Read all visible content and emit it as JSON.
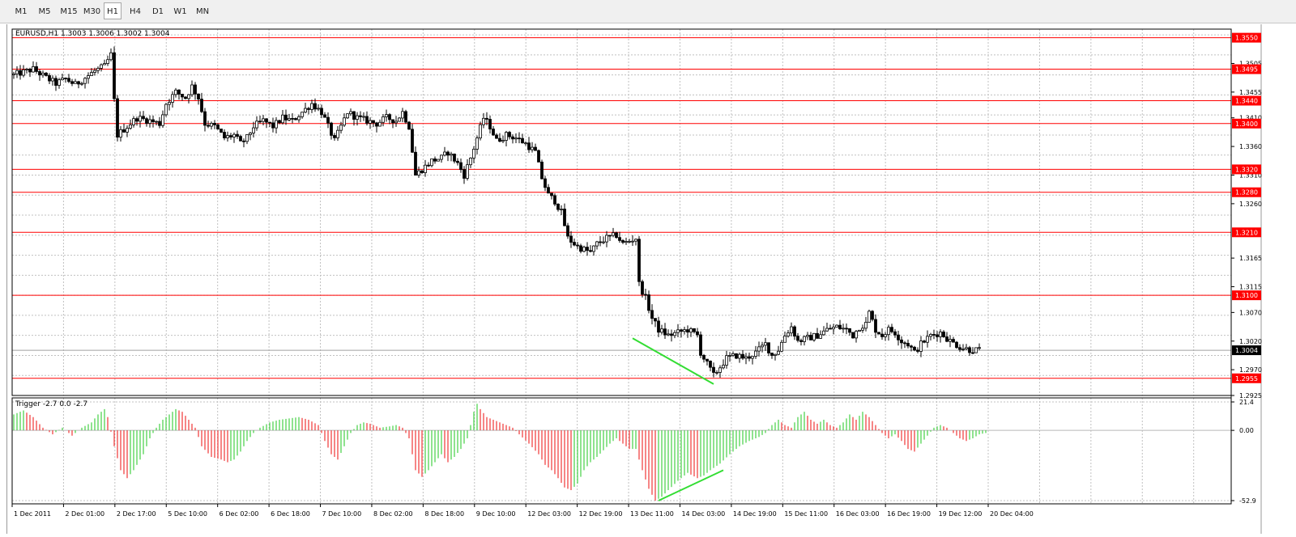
{
  "toolbar": {
    "timeframes": [
      "M1",
      "M5",
      "M15",
      "M30",
      "H1",
      "H4",
      "D1",
      "W1",
      "MN"
    ],
    "active": "H1"
  },
  "chart": {
    "header": "EURUSD,H1  1.3003 1.3006 1.3002 1.3004",
    "symbol": "EURUSD",
    "timeframe": "H1",
    "ohlc": [
      1.3003,
      1.3006,
      1.3002,
      1.3004
    ],
    "current_price": "1.3004",
    "colors": {
      "level_line": "#ff0000",
      "candle": "#000000",
      "trendline": "#33dd33",
      "bar_up": "#33cc33",
      "bar_down": "#ee2222"
    }
  },
  "indicator": {
    "header": "Trigger -2.7 0.0 -2.7",
    "name": "Trigger",
    "values": [
      -2.7,
      0.0,
      -2.7
    ]
  },
  "chart_data": [
    {
      "type": "candlestick",
      "series_name": "EURUSD,H1",
      "ylim": [
        1.2925,
        1.3565
      ],
      "y_ticks": [
        "1.3550",
        "1.3505",
        "1.3495",
        "1.3455",
        "1.3440",
        "1.3410",
        "1.3400",
        "1.3360",
        "1.3320",
        "1.3310",
        "1.3280",
        "1.3260",
        "1.3210",
        "1.3165",
        "1.3115",
        "1.3100",
        "1.3070",
        "1.3020",
        "1.3004",
        "1.2970",
        "1.2955",
        "1.2925"
      ],
      "x_ticks": [
        "1 Dec 2011",
        "2 Dec 01:00",
        "2 Dec 17:00",
        "5 Dec 10:00",
        "6 Dec 02:00",
        "6 Dec 18:00",
        "7 Dec 10:00",
        "8 Dec 02:00",
        "8 Dec 18:00",
        "9 Dec 10:00",
        "12 Dec 03:00",
        "12 Dec 19:00",
        "13 Dec 11:00",
        "14 Dec 03:00",
        "14 Dec 19:00",
        "15 Dec 11:00",
        "16 Dec 03:00",
        "16 Dec 19:00",
        "19 Dec 12:00",
        "20 Dec 04:00"
      ],
      "horizontal_levels": [
        "1.3550",
        "1.3495",
        "1.3440",
        "1.3400",
        "1.3320",
        "1.3280",
        "1.3210",
        "1.3100",
        "1.2955"
      ],
      "close_path": [
        [
          0,
          1.3485
        ],
        [
          3,
          1.349
        ],
        [
          6,
          1.3495
        ],
        [
          10,
          1.348
        ],
        [
          13,
          1.347
        ],
        [
          16,
          1.3478
        ],
        [
          19,
          1.3468
        ],
        [
          22,
          1.348
        ],
        [
          25,
          1.3492
        ],
        [
          28,
          1.35
        ],
        [
          30,
          1.352
        ],
        [
          31,
          1.344
        ],
        [
          32,
          1.338
        ],
        [
          35,
          1.3395
        ],
        [
          38,
          1.341
        ],
        [
          42,
          1.3405
        ],
        [
          45,
          1.34
        ],
        [
          47,
          1.3435
        ],
        [
          50,
          1.3455
        ],
        [
          53,
          1.3445
        ],
        [
          55,
          1.3465
        ],
        [
          57,
          1.3445
        ],
        [
          59,
          1.34
        ],
        [
          62,
          1.3395
        ],
        [
          65,
          1.3375
        ],
        [
          68,
          1.338
        ],
        [
          70,
          1.3365
        ],
        [
          72,
          1.3375
        ],
        [
          74,
          1.3395
        ],
        [
          77,
          1.3405
        ],
        [
          80,
          1.3395
        ],
        [
          83,
          1.341
        ],
        [
          86,
          1.3405
        ],
        [
          89,
          1.342
        ],
        [
          92,
          1.3435
        ],
        [
          95,
          1.342
        ],
        [
          97,
          1.3395
        ],
        [
          99,
          1.337
        ],
        [
          101,
          1.3395
        ],
        [
          103,
          1.342
        ],
        [
          106,
          1.341
        ],
        [
          109,
          1.3405
        ],
        [
          112,
          1.34
        ],
        [
          115,
          1.341
        ],
        [
          118,
          1.3405
        ],
        [
          120,
          1.342
        ],
        [
          122,
          1.3395
        ],
        [
          124,
          1.331
        ],
        [
          126,
          1.332
        ],
        [
          129,
          1.3335
        ],
        [
          132,
          1.334
        ],
        [
          134,
          1.335
        ],
        [
          137,
          1.333
        ],
        [
          139,
          1.331
        ],
        [
          141,
          1.334
        ],
        [
          143,
          1.3375
        ],
        [
          145,
          1.341
        ],
        [
          147,
          1.3395
        ],
        [
          149,
          1.337
        ],
        [
          152,
          1.338
        ],
        [
          155,
          1.3375
        ],
        [
          158,
          1.3365
        ],
        [
          161,
          1.335
        ],
        [
          163,
          1.3305
        ],
        [
          165,
          1.3275
        ],
        [
          167,
          1.3265
        ],
        [
          169,
          1.3245
        ],
        [
          171,
          1.32
        ],
        [
          174,
          1.3185
        ],
        [
          176,
          1.318
        ],
        [
          178,
          1.3175
        ],
        [
          180,
          1.319
        ],
        [
          183,
          1.32
        ],
        [
          186,
          1.3205
        ],
        [
          188,
          1.319
        ],
        [
          190,
          1.3195
        ],
        [
          192,
          1.32
        ],
        [
          193,
          1.312
        ],
        [
          195,
          1.3095
        ],
        [
          197,
          1.306
        ],
        [
          199,
          1.304
        ],
        [
          202,
          1.303
        ],
        [
          205,
          1.3035
        ],
        [
          208,
          1.304
        ],
        [
          211,
          1.303
        ],
        [
          212,
          1.3
        ],
        [
          214,
          1.298
        ],
        [
          216,
          1.296
        ],
        [
          218,
          1.2975
        ],
        [
          220,
          1.299
        ],
        [
          223,
          1.2995
        ],
        [
          226,
          1.299
        ],
        [
          229,
          1.3
        ],
        [
          232,
          1.3015
        ],
        [
          234,
          1.2995
        ],
        [
          236,
          1.3005
        ],
        [
          238,
          1.303
        ],
        [
          240,
          1.3045
        ],
        [
          242,
          1.302
        ],
        [
          245,
          1.3025
        ],
        [
          248,
          1.303
        ],
        [
          251,
          1.304
        ],
        [
          254,
          1.3045
        ],
        [
          257,
          1.304
        ],
        [
          259,
          1.303
        ],
        [
          261,
          1.3045
        ],
        [
          263,
          1.305
        ],
        [
          264,
          1.307
        ],
        [
          266,
          1.304
        ],
        [
          268,
          1.303
        ],
        [
          270,
          1.304
        ],
        [
          272,
          1.3035
        ],
        [
          274,
          1.302
        ],
        [
          276,
          1.3015
        ],
        [
          278,
          1.3
        ],
        [
          280,
          1.3015
        ],
        [
          283,
          1.303
        ],
        [
          286,
          1.3035
        ],
        [
          289,
          1.302
        ],
        [
          292,
          1.301
        ],
        [
          295,
          1.3005
        ],
        [
          298,
          1.3004
        ]
      ]
    },
    {
      "type": "histogram",
      "series_name": "Trigger",
      "ylim": [
        -52.9,
        21.4
      ],
      "y_ticks": [
        "21.4",
        "0.00",
        "-52.9"
      ],
      "current_values": [
        -2.7,
        0.0,
        -2.7
      ],
      "path": [
        [
          0,
          12
        ],
        [
          3,
          15
        ],
        [
          6,
          10
        ],
        [
          9,
          2
        ],
        [
          12,
          -3
        ],
        [
          15,
          2
        ],
        [
          18,
          -4
        ],
        [
          21,
          2
        ],
        [
          24,
          6
        ],
        [
          26,
          12
        ],
        [
          28,
          16
        ],
        [
          29,
          10
        ],
        [
          31,
          -12
        ],
        [
          33,
          -30
        ],
        [
          35,
          -36
        ],
        [
          37,
          -30
        ],
        [
          40,
          -18
        ],
        [
          42,
          -6
        ],
        [
          44,
          2
        ],
        [
          46,
          8
        ],
        [
          48,
          12
        ],
        [
          50,
          16
        ],
        [
          52,
          14
        ],
        [
          54,
          8
        ],
        [
          56,
          2
        ],
        [
          58,
          -12
        ],
        [
          61,
          -20
        ],
        [
          64,
          -22
        ],
        [
          66,
          -24
        ],
        [
          68,
          -22
        ],
        [
          70,
          -16
        ],
        [
          72,
          -8
        ],
        [
          74,
          -2
        ],
        [
          76,
          2
        ],
        [
          79,
          6
        ],
        [
          82,
          8
        ],
        [
          85,
          9
        ],
        [
          88,
          10
        ],
        [
          91,
          8
        ],
        [
          94,
          4
        ],
        [
          96,
          -8
        ],
        [
          98,
          -18
        ],
        [
          100,
          -22
        ],
        [
          102,
          -12
        ],
        [
          104,
          -2
        ],
        [
          106,
          4
        ],
        [
          108,
          6
        ],
        [
          110,
          5
        ],
        [
          113,
          2
        ],
        [
          116,
          3
        ],
        [
          118,
          4
        ],
        [
          120,
          2
        ],
        [
          122,
          -6
        ],
        [
          124,
          -30
        ],
        [
          126,
          -35
        ],
        [
          128,
          -30
        ],
        [
          130,
          -24
        ],
        [
          132,
          -18
        ],
        [
          134,
          -24
        ],
        [
          136,
          -20
        ],
        [
          138,
          -14
        ],
        [
          140,
          -6
        ],
        [
          141,
          4
        ],
        [
          142,
          14
        ],
        [
          143,
          20
        ],
        [
          144,
          16
        ],
        [
          146,
          10
        ],
        [
          148,
          8
        ],
        [
          150,
          6
        ],
        [
          152,
          4
        ],
        [
          154,
          2
        ],
        [
          156,
          -3
        ],
        [
          159,
          -10
        ],
        [
          162,
          -18
        ],
        [
          164,
          -26
        ],
        [
          166,
          -30
        ],
        [
          168,
          -36
        ],
        [
          170,
          -43
        ],
        [
          172,
          -45
        ],
        [
          174,
          -40
        ],
        [
          176,
          -30
        ],
        [
          178,
          -24
        ],
        [
          180,
          -20
        ],
        [
          182,
          -15
        ],
        [
          184,
          -10
        ],
        [
          186,
          -6
        ],
        [
          188,
          -10
        ],
        [
          190,
          -14
        ],
        [
          192,
          -14
        ],
        [
          194,
          -30
        ],
        [
          196,
          -44
        ],
        [
          198,
          -53
        ],
        [
          200,
          -50
        ],
        [
          202,
          -45
        ],
        [
          205,
          -38
        ],
        [
          208,
          -32
        ],
        [
          211,
          -36
        ],
        [
          213,
          -34
        ],
        [
          215,
          -30
        ],
        [
          218,
          -25
        ],
        [
          221,
          -18
        ],
        [
          224,
          -12
        ],
        [
          227,
          -8
        ],
        [
          230,
          -5
        ],
        [
          232,
          -2
        ],
        [
          234,
          4
        ],
        [
          236,
          8
        ],
        [
          238,
          4
        ],
        [
          240,
          2
        ],
        [
          242,
          10
        ],
        [
          244,
          14
        ],
        [
          246,
          8
        ],
        [
          248,
          5
        ],
        [
          250,
          8
        ],
        [
          252,
          4
        ],
        [
          254,
          2
        ],
        [
          256,
          6
        ],
        [
          258,
          12
        ],
        [
          260,
          8
        ],
        [
          262,
          14
        ],
        [
          264,
          10
        ],
        [
          266,
          4
        ],
        [
          268,
          -2
        ],
        [
          270,
          -6
        ],
        [
          272,
          -3
        ],
        [
          274,
          -8
        ],
        [
          276,
          -14
        ],
        [
          278,
          -16
        ],
        [
          280,
          -10
        ],
        [
          282,
          -4
        ],
        [
          284,
          2
        ],
        [
          286,
          4
        ],
        [
          288,
          2
        ],
        [
          290,
          -2
        ],
        [
          292,
          -6
        ],
        [
          294,
          -8
        ],
        [
          296,
          -6
        ],
        [
          298,
          -3
        ],
        [
          300,
          -2
        ]
      ]
    }
  ]
}
